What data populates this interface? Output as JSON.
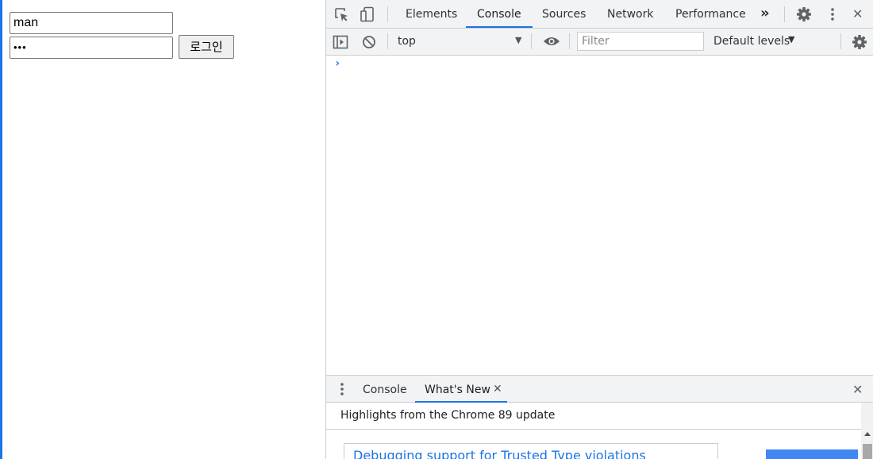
{
  "page": {
    "username_value": "man",
    "password_value": "•••",
    "login_label": "로그인"
  },
  "devtools": {
    "main_tabs": [
      {
        "label": "Elements"
      },
      {
        "label": "Console"
      },
      {
        "label": "Sources"
      },
      {
        "label": "Network"
      },
      {
        "label": "Performance"
      }
    ],
    "more_tabs_glyph": "»",
    "close_glyph": "✕",
    "console_toolbar": {
      "context": "top",
      "dropdown_glyph": "▼",
      "filter_placeholder": "Filter",
      "levels": "Default levels"
    },
    "prompt_glyph": "›",
    "drawer": {
      "tabs": [
        {
          "label": "Console"
        },
        {
          "label": "What's New"
        }
      ],
      "tab_close_glyph": "✕",
      "close_glyph": "✕",
      "highlights": "Highlights from the Chrome 89 update",
      "feature_title": "Debugging support for Trusted Type violations"
    }
  },
  "icons": {
    "inspect": "inspect-element-icon",
    "device": "device-toolbar-icon",
    "settings": "gear-icon",
    "kebab": "kebab-menu-icon",
    "sidebar": "console-sidebar-icon",
    "clear": "clear-console-icon",
    "eye": "eye-icon"
  },
  "colors": {
    "accent": "#1a73e8",
    "toolbar_bg": "#f1f3f4",
    "border": "#cbcdd1"
  }
}
